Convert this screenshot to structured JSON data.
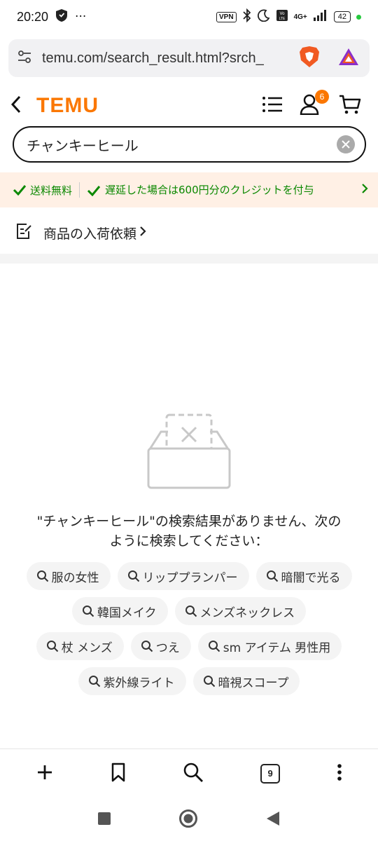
{
  "status_bar": {
    "time": "20:20",
    "more": "···",
    "vpn": "VPN",
    "network": "4G+",
    "battery": "42"
  },
  "url_bar": {
    "url": "temu.com/search_result.html?srch_"
  },
  "header": {
    "logo": "TEMU",
    "cart_badge": "6"
  },
  "search": {
    "query": "チャンキーヒール"
  },
  "promo": {
    "item1": "送料無料",
    "item2": "遅延した場合は600円分のクレジットを付与"
  },
  "request": {
    "label": "商品の入荷依頼"
  },
  "empty_state": {
    "message": "\"チャンキーヒール\"の検索結果がありません、次のように検索してください："
  },
  "suggestions": [
    "服の女性",
    "リッププランパー",
    "暗闇で光る",
    "韓国メイク",
    "メンズネックレス",
    "杖 メンズ",
    "つえ",
    "sm アイテム 男性用",
    "紫外線ライト",
    "暗視スコープ"
  ],
  "bottom_bar": {
    "tab_count": "9"
  },
  "colors": {
    "brand": "#fb7701",
    "promo_text": "#0a8800",
    "promo_bg": "#fff0e5"
  }
}
